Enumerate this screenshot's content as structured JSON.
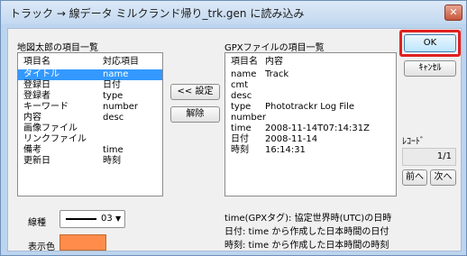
{
  "window": {
    "title": "トラック → 線データ ミルクランド帰り_trk.gen に読み込み",
    "close_glyph": "✕"
  },
  "left_panel": {
    "heading": "地図太郎の項目一覧",
    "columns": [
      "項目名",
      "対応項目"
    ],
    "rows": [
      {
        "name": "タイトル",
        "value": "name",
        "selected": true
      },
      {
        "name": "登録日",
        "value": "日付"
      },
      {
        "name": "登録者",
        "value": "type"
      },
      {
        "name": "キーワード",
        "value": "number"
      },
      {
        "name": "内容",
        "value": "desc"
      },
      {
        "name": "画像ファイル",
        "value": ""
      },
      {
        "name": "リンクファイル",
        "value": ""
      },
      {
        "name": "備考",
        "value": "time"
      },
      {
        "name": "更新日",
        "value": "時刻"
      }
    ]
  },
  "middle_buttons": {
    "set_label": "<< 設定",
    "unset_label": "解除"
  },
  "right_panel": {
    "heading": "GPXファイルの項目一覧",
    "columns": [
      "項目名",
      "内容"
    ],
    "rows": [
      {
        "name": "name",
        "value": "Track"
      },
      {
        "name": "cmt",
        "value": ""
      },
      {
        "name": "desc",
        "value": ""
      },
      {
        "name": "type",
        "value": "Phototrackr Log File"
      },
      {
        "name": "number",
        "value": ""
      },
      {
        "name": "time",
        "value": "2008-11-14T07:14:31Z"
      },
      {
        "name": "日付",
        "value": "2008-11-14"
      },
      {
        "name": "時刻",
        "value": "16:14:31"
      }
    ]
  },
  "actions": {
    "ok_label": "OK",
    "cancel_label": "ｷｬﾝｾﾙ"
  },
  "record": {
    "label": "ﾚｺｰﾄﾞ",
    "counter": "1/1",
    "prev_label": "前へ",
    "next_label": "次へ"
  },
  "line_type": {
    "label": "線種",
    "value": "03"
  },
  "display_color": {
    "label": "表示色",
    "color": "#ff8c4a"
  },
  "notes": [
    "time(GPXタグ): 協定世界時(UTC)の日時",
    "日付: time から作成した日本時間の日付",
    "時刻: time から作成した日本時間の時刻"
  ],
  "colors": {
    "selection": "#3399ff",
    "ok_highlight": "#e02020"
  }
}
